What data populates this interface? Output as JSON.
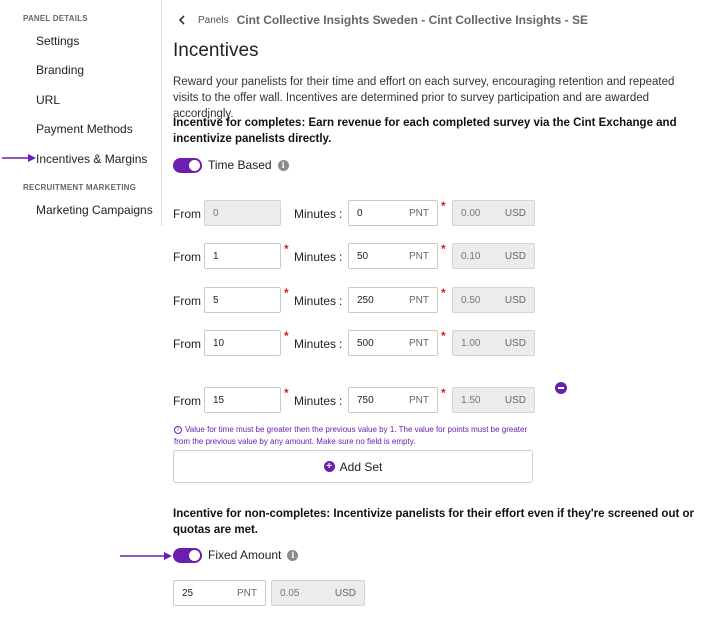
{
  "sidebar": {
    "panel_details_heading": "PANEL DETAILS",
    "items": [
      {
        "label": "Settings"
      },
      {
        "label": "Branding"
      },
      {
        "label": "URL"
      },
      {
        "label": "Payment Methods"
      },
      {
        "label": "Incentives & Margins"
      }
    ],
    "recruitment_heading": "RECRUITMENT MARKETING",
    "recruitment_items": [
      {
        "label": "Marketing Campaigns"
      }
    ]
  },
  "breadcrumb": {
    "link": "Panels",
    "title": "Cint Collective Insights Sweden - Cint Collective Insights - SE"
  },
  "page": {
    "title": "Incentives",
    "description": "Reward your panelists for their time and effort on each survey, encouraging retention and repeated visits to the offer wall. Incentives are determined prior to survey participation and are awarded accordingly."
  },
  "completes": {
    "section_title": "Incentive for completes: Earn revenue for each completed survey via the Cint Exchange and incentivize panelists directly.",
    "toggle_label": "Time Based",
    "from_label": "From",
    "minutes_label": "Minutes",
    "separator": ":",
    "points_unit": "PNT",
    "currency_unit": "USD",
    "rows": [
      {
        "from": "0",
        "points": "0",
        "usd": "0.00"
      },
      {
        "from": "1",
        "points": "50",
        "usd": "0.10"
      },
      {
        "from": "5",
        "points": "250",
        "usd": "0.50"
      },
      {
        "from": "10",
        "points": "500",
        "usd": "1.00"
      },
      {
        "from": "15",
        "points": "750",
        "usd": "1.50"
      }
    ],
    "hint": "Value for time must be greater then the previous value by 1. The value for points must be greater from the previous value by any amount. Make sure no field is empty.",
    "add_set_label": "Add Set"
  },
  "non_completes": {
    "section_title": "Incentive for non-completes: Incentivize panelists for their effort even if they're screened out or quotas are met.",
    "toggle_label": "Fixed Amount",
    "points": "25",
    "points_unit": "PNT",
    "usd": "0.05",
    "currency_unit": "USD"
  },
  "colors": {
    "accent": "#6b1fb1",
    "required": "#d62020"
  }
}
